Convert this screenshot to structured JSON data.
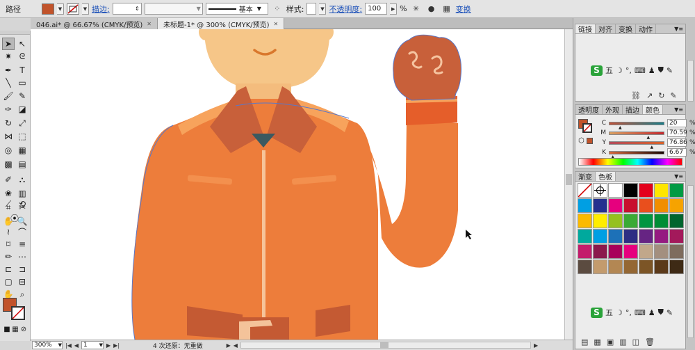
{
  "control_bar": {
    "selection_label": "路径",
    "fill_color": "#c1532b",
    "stroke_label": "描边:",
    "stroke_profile": "基本",
    "style_label": "样式:",
    "opacity_label": "不透明度:",
    "opacity_value": "100",
    "opacity_unit": "%",
    "transform_link": "变换"
  },
  "tabs": [
    {
      "label": "046.ai* @ 66.67% (CMYK/预览)",
      "active": false
    },
    {
      "label": "未标题-1* @ 300% (CMYK/预览)",
      "active": true
    }
  ],
  "status": {
    "zoom": "300%",
    "page": "1",
    "history": "4 次还原：无重做"
  },
  "panels": {
    "top_tabs": [
      "链接",
      "对齐",
      "变换",
      "动作"
    ],
    "ime_label": "五",
    "color_tabs": [
      "透明度",
      "外观",
      "描边",
      "颜色"
    ],
    "cmyk": [
      {
        "channel": "C",
        "value": "20",
        "percent": 20
      },
      {
        "channel": "M",
        "value": "70.59",
        "percent": 70.59
      },
      {
        "channel": "Y",
        "value": "76.86",
        "percent": 76.86
      },
      {
        "channel": "K",
        "value": "6.67",
        "percent": 6.67
      }
    ],
    "swatch_tabs": [
      "渐变",
      "色板"
    ],
    "swatches": [
      "#ffffff",
      "#ffffff",
      "#ffffff",
      "#000000",
      "#e3001b",
      "#ffe600",
      "#009a44",
      "#009fe3",
      "#24318f",
      "#e6007e",
      "#c8102e",
      "#e94f1d",
      "#f18e00",
      "#f6a300",
      "#fbba00",
      "#ffed00",
      "#95c11f",
      "#3aaa35",
      "#009640",
      "#008d36",
      "#00652e",
      "#00a99d",
      "#009fe3",
      "#1d71b8",
      "#2d2e83",
      "#662483",
      "#951b81",
      "#a3195b",
      "#c31c6b",
      "#8b1a4d",
      "#a8005a",
      "#e6007e",
      "#c1a78a",
      "#a38f7f",
      "#7e6c5e",
      "#5b4b40",
      "#c39b6d",
      "#b38753",
      "#946734",
      "#7c5526",
      "#5b3a1a",
      "#3e2a15"
    ]
  }
}
